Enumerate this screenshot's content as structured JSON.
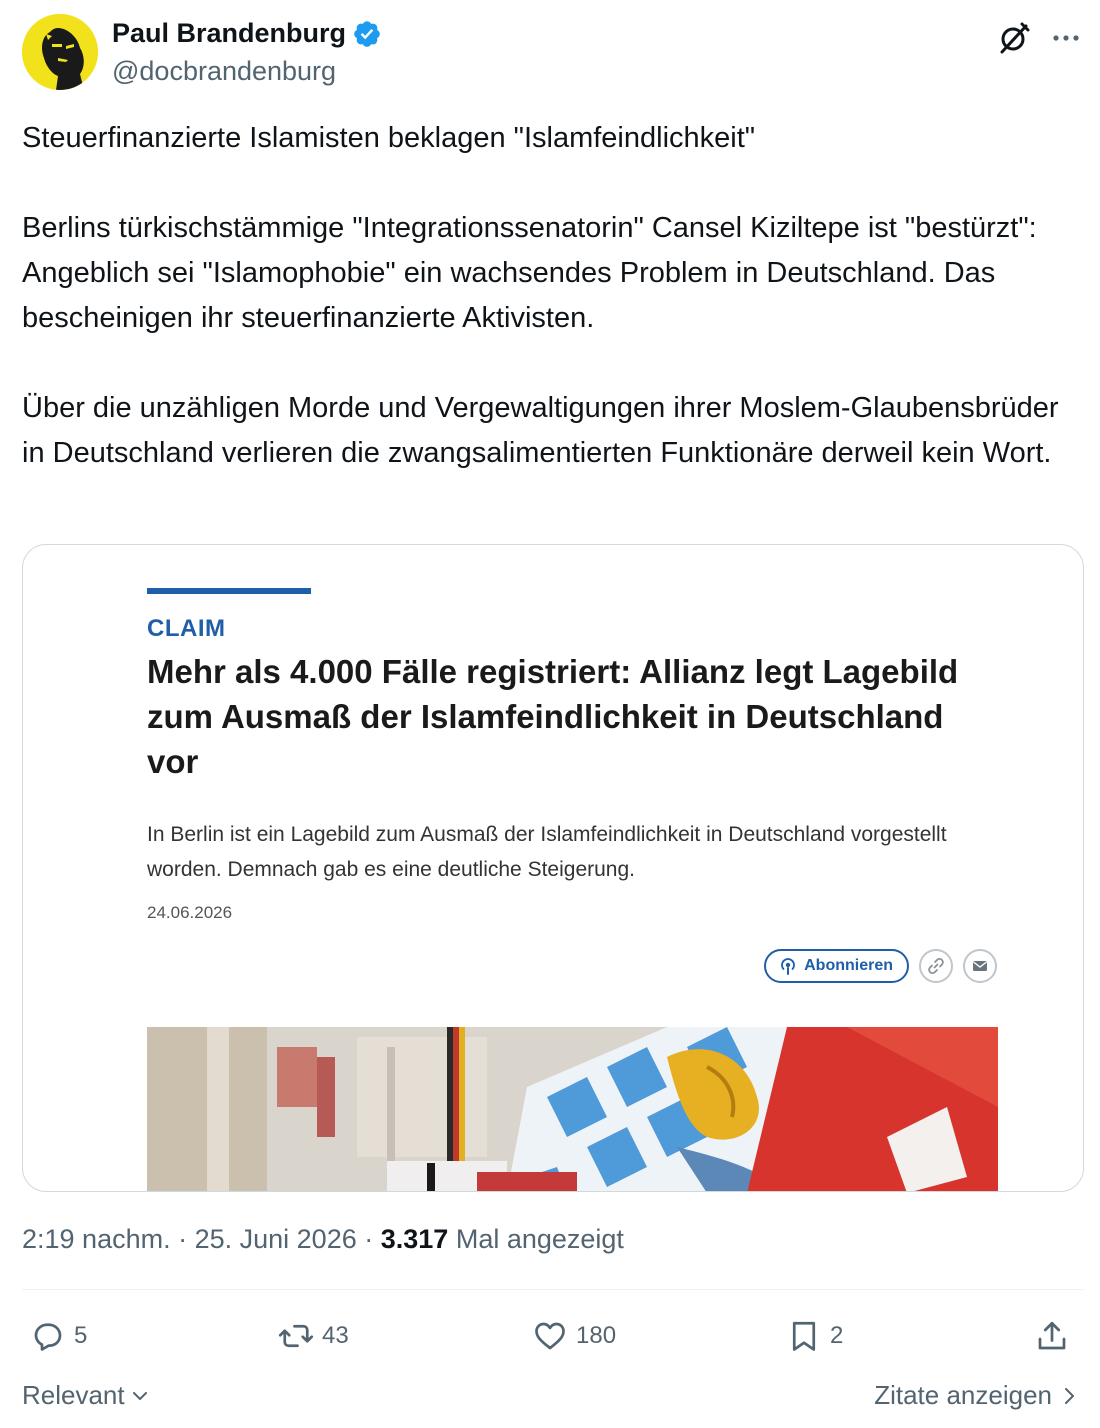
{
  "author": {
    "name": "Paul Brandenburg",
    "handle": "@docbrandenburg",
    "verified": true
  },
  "tweet": {
    "paragraphs": [
      "Steuerfinanzierte Islamisten beklagen \"Islamfeindlichkeit\"",
      "Berlins türkischstämmige \"Integrationssenatorin\" Cansel Kiziltepe ist \"bestürzt\": Angeblich sei \"Islamophobie\" ein wachsendes Problem in Deutschland. Das bescheinigen ihr steuerfinanzierte Aktivisten.",
      "Über die unzähligen Morde und Vergewaltigungen ihrer Moslem-Glaubensbrüder in Deutschland verlieren die zwangsalimentierten Funktionäre derweil kein Wort."
    ]
  },
  "card": {
    "kicker": "CLAIM",
    "title": "Mehr als 4.000 Fälle registriert: Allianz legt Lagebild zum Ausmaß der Islamfeindlichkeit in Deutschland vor",
    "teaser": "In Berlin ist ein Lagebild zum Ausmaß der Islamfeindlichkeit in Deutschland vorgestellt worden. Demnach gab es eine deutliche Steigerung.",
    "date": "24.06.2026",
    "subscribe_label": "Abonnieren"
  },
  "meta": {
    "time": "2:19 nachm.",
    "separator": " · ",
    "date": "25. Juni 2026",
    "views_count": "3.317",
    "views_label": "Mal angezeigt"
  },
  "actions": {
    "replies": "5",
    "reposts": "43",
    "likes": "180",
    "bookmarks": "2"
  },
  "footer": {
    "sort_label": "Relevant",
    "quotes_label": "Zitate anzeigen"
  },
  "colors": {
    "brand_blue": "#1d9bf0",
    "card_accent": "#1f5ea8",
    "avatar_bg": "#f2e21b",
    "muted_text": "#536471"
  }
}
